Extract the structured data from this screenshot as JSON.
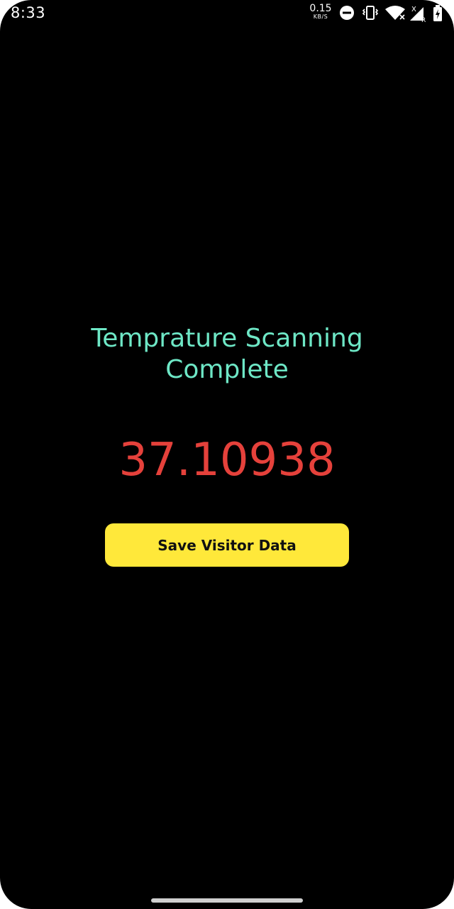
{
  "status_bar": {
    "time": "8:33",
    "net_speed_value": "0.15",
    "net_speed_unit": "KB/S",
    "icons": [
      "do-not-disturb-icon",
      "vibrate-icon",
      "wifi-icon",
      "cellular-signal-icon",
      "battery-charging-icon"
    ]
  },
  "main": {
    "title_line1": "Temprature Scanning",
    "title_line2": "Complete",
    "temperature": "37.10938",
    "save_button_label": "Save Visitor Data"
  },
  "colors": {
    "background": "#000000",
    "title": "#6ee7c6",
    "temperature": "#e5413b",
    "button": "#ffe83a",
    "button_text": "#111111"
  }
}
